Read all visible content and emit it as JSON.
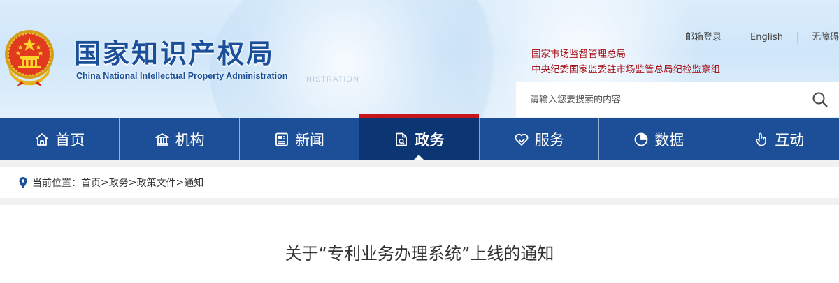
{
  "header": {
    "logo_cn": "国家知识产权局",
    "logo_en": "China National Intellectual Property Administration",
    "watermark": "NISTRATION",
    "emblem_icon": "national-emblem-icon",
    "top_links": {
      "mail_login": "邮箱登录",
      "english": "English",
      "accessibility": "无障碍"
    },
    "affiliations": [
      "国家市场监督管理总局",
      "中央纪委国家监委驻市场监管总局纪检监察组"
    ],
    "search": {
      "placeholder": "请输入您要搜索的内容",
      "icon": "search-icon"
    }
  },
  "nav": {
    "items": [
      {
        "label": "首页",
        "icon": "home-icon"
      },
      {
        "label": "机构",
        "icon": "building-icon"
      },
      {
        "label": "新闻",
        "icon": "newspaper-icon"
      },
      {
        "label": "政务",
        "icon": "document-icon",
        "active": true
      },
      {
        "label": "服务",
        "icon": "heart-hand-icon"
      },
      {
        "label": "数据",
        "icon": "pie-chart-icon"
      },
      {
        "label": "互动",
        "icon": "hand-pointer-icon"
      }
    ]
  },
  "breadcrumb": {
    "prefix": "当前位置：",
    "items": [
      "首页",
      "政务",
      "政策文件",
      "通知"
    ],
    "separator": ">",
    "icon": "location-pin-icon"
  },
  "article": {
    "title": "关于“专利业务办理系统”上线的通知"
  },
  "colors": {
    "nav_bg": "#1d4f98",
    "nav_active_bg": "#0c3574",
    "nav_active_accent": "#c8161d",
    "logo_blue": "#1b4f9a",
    "affiliation_red": "#a8141a",
    "header_bg": "#d6eaf9",
    "breadcrumb_bg": "#f1f1f1"
  }
}
